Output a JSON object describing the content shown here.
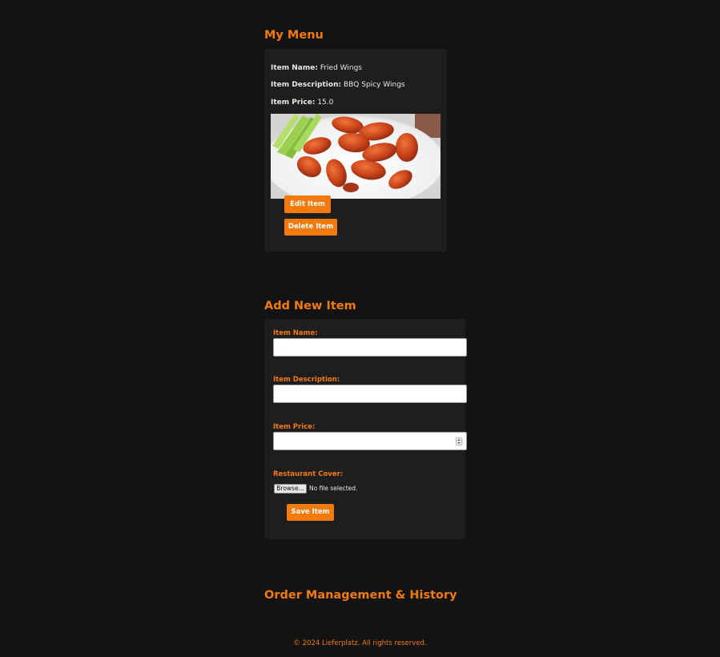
{
  "menu_section": {
    "title": "My Menu",
    "item": {
      "name_label": "Item Name:",
      "name_value": "Fried Wings",
      "description_label": "Item Description:",
      "description_value": "BBQ Spicy Wings",
      "price_label": "Item Price:",
      "price_value": "15.0",
      "edit_label": "Edit Item",
      "delete_label": "Delete Item"
    }
  },
  "add_section": {
    "title": "Add New Item",
    "name_label": "Item Name:",
    "name_value": "",
    "description_label": "Item Description:",
    "description_value": "",
    "price_label": "Item Price:",
    "price_value": "",
    "cover_label": "Restaurant Cover:",
    "browse_label": "Browse...",
    "no_file_text": "No file selected.",
    "save_label": "Save Item"
  },
  "orders_section": {
    "title": "Order Management & History"
  },
  "footer": {
    "text": "© 2024 Lieferplatz. All rights reserved."
  },
  "colors": {
    "background": "#131313",
    "card": "#1e1e1e",
    "accent": "#f47a0c"
  }
}
